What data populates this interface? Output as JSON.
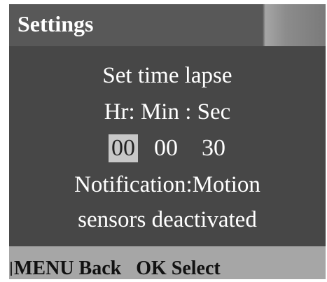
{
  "header": {
    "title": "Settings"
  },
  "content": {
    "heading": "Set time lapse",
    "time_format": "Hr: Min : Sec",
    "time": {
      "hours": "00",
      "minutes": "00",
      "seconds": "30"
    },
    "notification_line1": "Notification:Motion",
    "notification_line2": "sensors deactivated"
  },
  "footer": {
    "hint": "MENU Back   OK Select"
  },
  "colors": {
    "screen_background": "#474747",
    "header_background": "#585858",
    "footer_background": "#a6a6a6",
    "selected_field": "#c8c8c8",
    "text": "#ffffff"
  }
}
